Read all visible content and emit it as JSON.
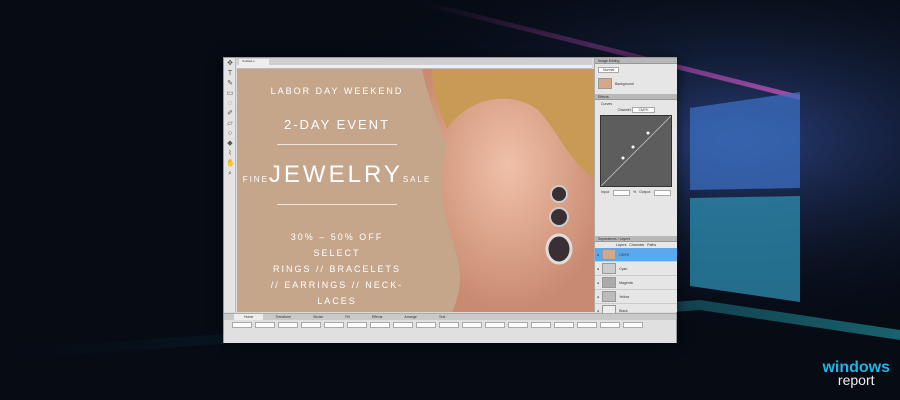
{
  "document": {
    "tab_label": "Untitled-1"
  },
  "ad": {
    "line1": "LABOR DAY WEEKEND",
    "line2": "2-DAY EVENT",
    "fine": "FINE",
    "jewelry": "JEWELRY",
    "sale": "SALE",
    "offer": [
      "30% – 50% OFF",
      "SELECT",
      "RINGS // BRACELETS",
      "// EARRINGS // NECK-",
      "LACES"
    ]
  },
  "panel": {
    "image_editing": "Image Editing",
    "mode": "Normal",
    "layer_name": "Background",
    "effects": "Effects",
    "curves": "Curves",
    "channel_label": "Channel:",
    "channel_value": "CMYK",
    "input_label": "Input:",
    "output_label": "Output:",
    "pct": "%",
    "layers_title": "Separations / Layers",
    "tabs": [
      "Layers",
      "Channels",
      "Paths"
    ],
    "layers": [
      "CMYK",
      "Cyan",
      "Magenta",
      "Yellow",
      "Black"
    ]
  },
  "bottom": {
    "tabs": [
      "Home",
      "Transform",
      "Stroke",
      "Fill",
      "Effects",
      "Arrange",
      "Text"
    ]
  },
  "watermark": {
    "line1": "windows",
    "line2": "report"
  },
  "colors": {
    "selected": "#5aa9ef",
    "canvas": "#c5a68b"
  }
}
